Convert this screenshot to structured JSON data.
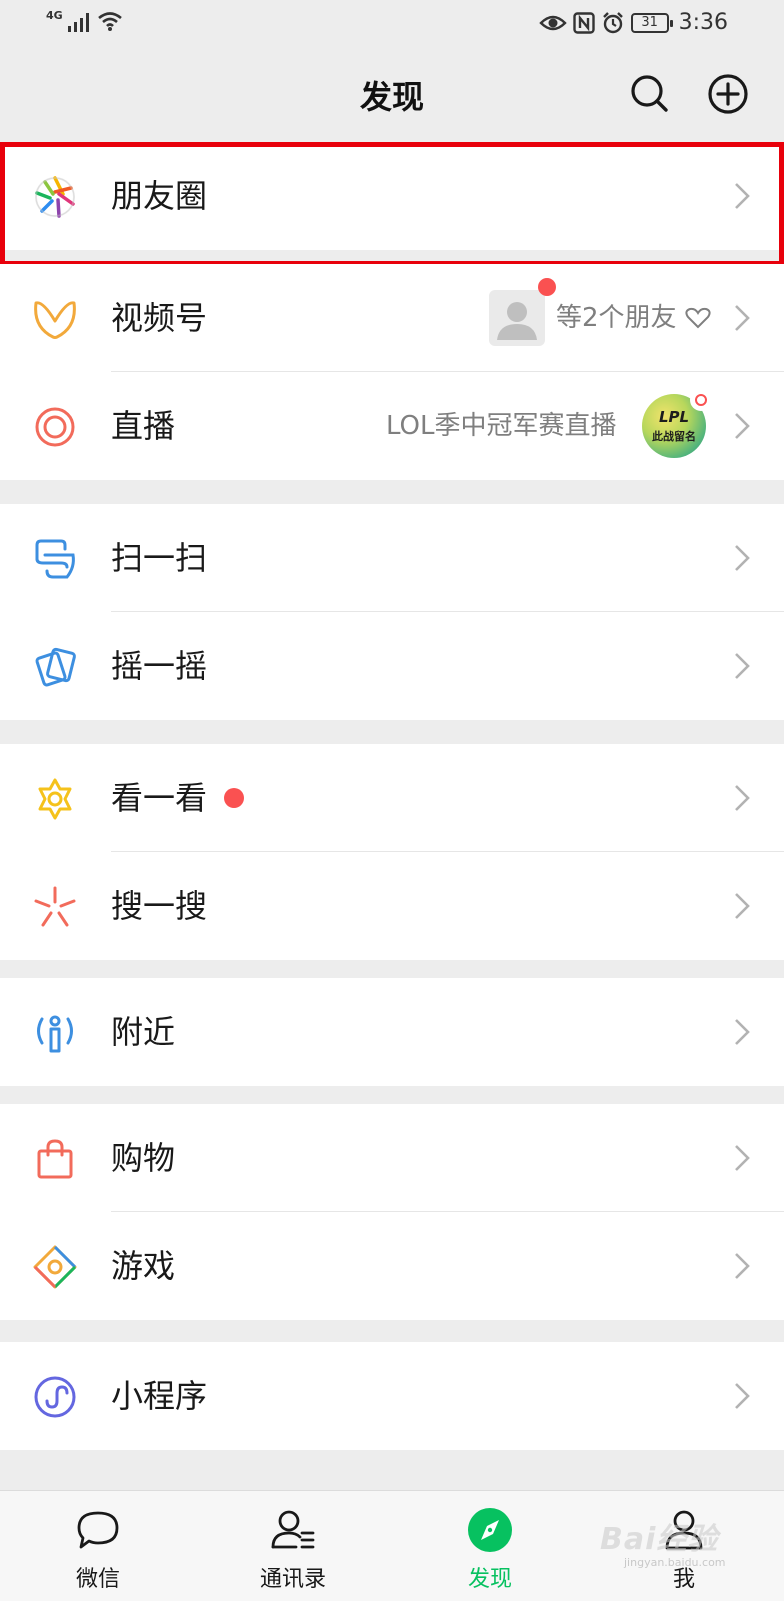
{
  "status_bar": {
    "network": "4G",
    "battery": "31",
    "time": "3:36"
  },
  "header": {
    "title": "发现",
    "search_icon": "search-icon",
    "add_icon": "plus-circle-icon"
  },
  "cells": {
    "moments": {
      "label": "朋友圈",
      "icon": "aperture-icon"
    },
    "channels": {
      "label": "视频号",
      "icon": "channels-icon",
      "detail": "等2个朋友"
    },
    "live": {
      "label": "直播",
      "icon": "live-icon",
      "detail": "LOL季中冠军赛直播",
      "thumb_text": "LPL",
      "thumb_sub": "此战留名"
    },
    "scan": {
      "label": "扫一扫",
      "icon": "scan-icon"
    },
    "shake": {
      "label": "摇一摇",
      "icon": "shake-icon"
    },
    "top_stories": {
      "label": "看一看",
      "icon": "top-stories-icon"
    },
    "search": {
      "label": "搜一搜",
      "icon": "search-sparkle-icon"
    },
    "nearby": {
      "label": "附近",
      "icon": "nearby-icon"
    },
    "shopping": {
      "label": "购物",
      "icon": "shopping-bag-icon"
    },
    "games": {
      "label": "游戏",
      "icon": "games-icon"
    },
    "mini_programs": {
      "label": "小程序",
      "icon": "mini-program-icon"
    }
  },
  "tabs": [
    {
      "label": "微信",
      "icon": "chat-bubble-icon",
      "active": false
    },
    {
      "label": "通讯录",
      "icon": "contacts-icon",
      "active": false
    },
    {
      "label": "发现",
      "icon": "compass-icon",
      "active": true
    },
    {
      "label": "我",
      "icon": "me-icon",
      "active": false
    }
  ],
  "watermark": {
    "text": "Bai经验",
    "sub": "jingyan.baidu.com"
  },
  "colors": {
    "accent": "#07c160",
    "badge": "#fa5151",
    "highlight": "#e8000b",
    "background": "#ededed"
  }
}
